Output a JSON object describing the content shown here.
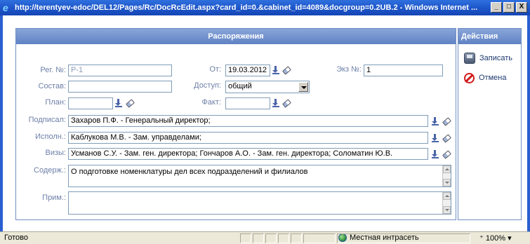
{
  "window": {
    "title": "http://terentyev-edoc/DEL12/Pages/Rc/DocRcEdit.aspx?card_id=0.&cabinet_id=4089&docgroup=0.2UB.2 - Windows Internet ...",
    "btn_min": "_",
    "btn_max": "□",
    "btn_close": "X"
  },
  "panel": {
    "title": "Распоряжения"
  },
  "actions": {
    "title": "Действия",
    "save": "Записать",
    "cancel": "Отмена"
  },
  "form": {
    "reg_label": "Рег. №:",
    "reg_value": "Р-1",
    "date_label": "От:",
    "date_value": "19.03.2012",
    "copy_label": "Экз №:",
    "copy_value": "1",
    "sostav_label": "Состав:",
    "sostav_value": "",
    "access_label": "Доступ:",
    "access_value": "общий",
    "plan_label": "План:",
    "plan_value": "",
    "fact_label": "Факт:",
    "fact_value": "",
    "signed_label": "Подписал:",
    "signed_value": "Захаров П.Ф. - Генеральный директор;",
    "exec_label": "Исполн.:",
    "exec_value": "Каблукова М.В. - Зам. управделами;",
    "visa_label": "Визы:",
    "visa_value": "Усманов С.У. - Зам. ген. директора; Гончаров А.О. - Зам. ген. директора; Соломатин Ю.В.",
    "content_label": "Содерж.:",
    "content_value": "О подготовке номенклатуры дел всех подразделений и филиалов",
    "note_label": "Прим.:",
    "note_value": ""
  },
  "status": {
    "text": "Готово",
    "zone": "Местная интрасеть",
    "zoom": "100%"
  }
}
